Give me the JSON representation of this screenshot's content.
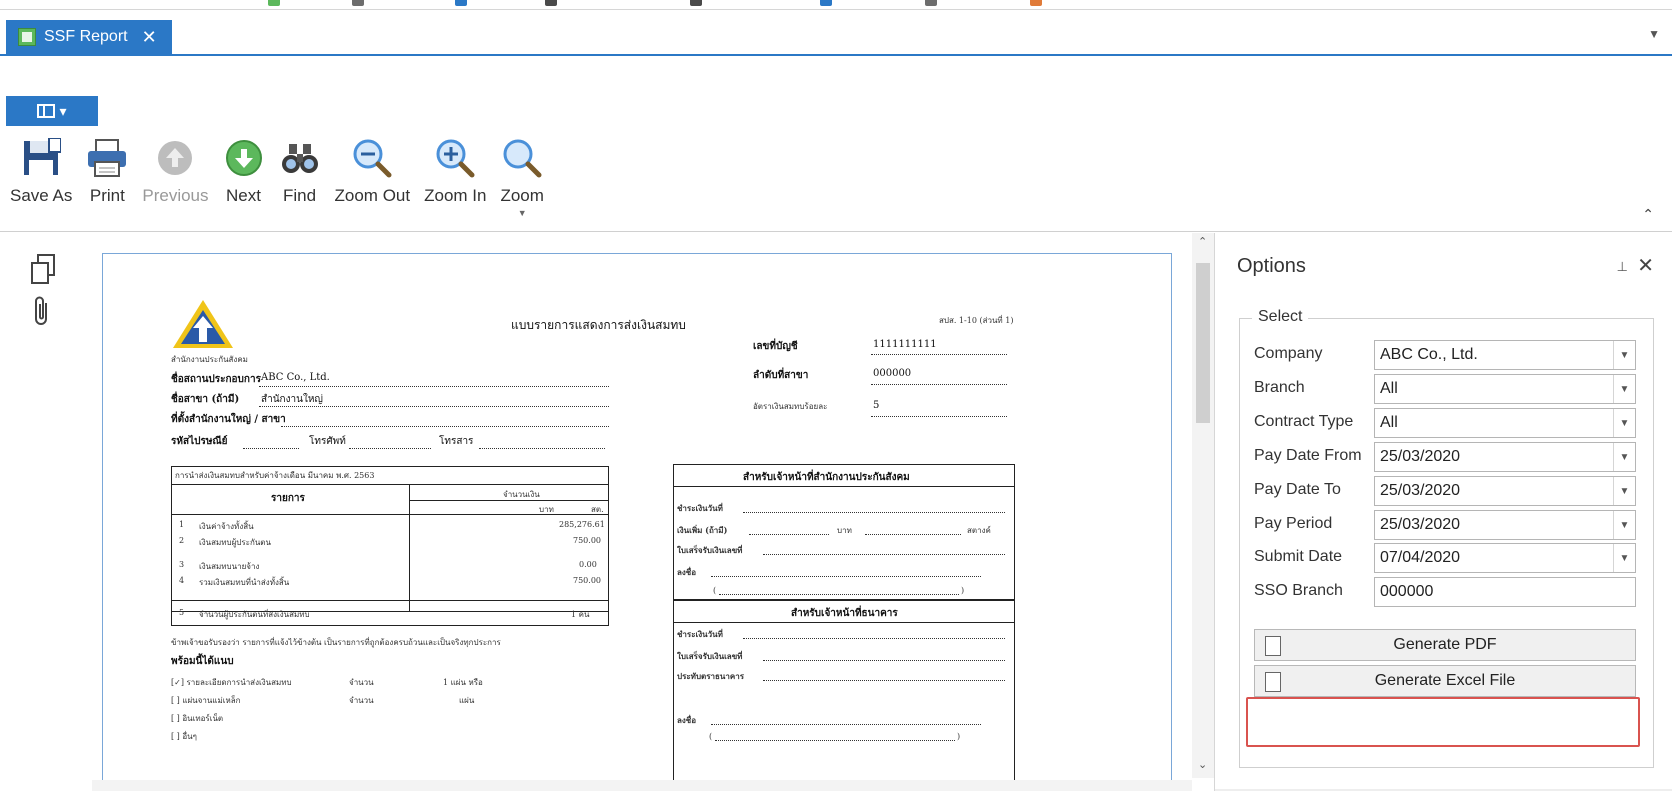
{
  "tab": {
    "title": "SSF Report",
    "close": "✕",
    "dropdown": "▼"
  },
  "ribbon": {
    "menu_button": "▾",
    "tools": [
      {
        "key": "save-as",
        "label": "Save As",
        "icon": "save-icon",
        "enabled": true
      },
      {
        "key": "print",
        "label": "Print",
        "icon": "printer-icon",
        "enabled": true
      },
      {
        "key": "previous",
        "label": "Previous",
        "icon": "arrow-up-icon",
        "enabled": false
      },
      {
        "key": "next",
        "label": "Next",
        "icon": "arrow-down-icon",
        "enabled": true
      },
      {
        "key": "find",
        "label": "Find",
        "icon": "binoculars-icon",
        "enabled": true
      },
      {
        "key": "zoom-out",
        "label": "Zoom Out",
        "icon": "zoom-out-icon",
        "enabled": true
      },
      {
        "key": "zoom-in",
        "label": "Zoom In",
        "icon": "zoom-in-icon",
        "enabled": true
      },
      {
        "key": "zoom",
        "label": "Zoom",
        "icon": "zoom-icon",
        "enabled": true
      }
    ],
    "collapse": "⌃"
  },
  "report": {
    "title": "แบบรายการแสดงการส่งเงินสมทบ",
    "form_no": "สปส. 1-10 (ส่วนที่ 1)",
    "logo_caption": "สำนักงานประกันสังคม",
    "employer_name_label": "ชื่อสถานประกอบการ",
    "employer_name": "ABC Co., Ltd.",
    "branch_label": "ชื่อสาขา (ถ้ามี)",
    "branch_value": "สำนักงานใหญ่",
    "address_label": "ที่ตั้งสำนักงานใหญ่ / สาขา",
    "postcode_label": "รหัสไปรษณีย์",
    "phone_label": "โทรศัพท์",
    "fax_label": "โทรสาร",
    "account_no_label": "เลขที่บัญชี",
    "account_no": "1111111111",
    "branch_no_label": "ลำดับที่สาขา",
    "branch_no": "000000",
    "rate_label": "อัตราเงินสมทบร้อยละ",
    "rate": "5",
    "period_line": "การนำส่งเงินสมทบสำหรับค่าจ้างเดือน มีนาคม พ.ศ. 2563",
    "col_items": "รายการ",
    "col_amount": "จำนวนเงิน",
    "col_baht": "บาท",
    "col_satang": "สต.",
    "rows": [
      {
        "no": "1",
        "text": "เงินค่าจ้างทั้งสิ้น",
        "amount": "285,276.61"
      },
      {
        "no": "2",
        "text": "เงินสมทบผู้ประกันตน",
        "amount": "750.00"
      },
      {
        "no": "3",
        "text": "เงินสมทบนายจ้าง",
        "amount": "0.00"
      },
      {
        "no": "4",
        "text": "รวมเงินสมทบที่นำส่งทั้งสิ้น",
        "amount": "750.00"
      },
      {
        "no": "5",
        "text": "จำนวนผู้ประกันตนที่ส่งเงินสมทบ",
        "amount": "1 คน"
      }
    ],
    "note_line": "ข้าพเจ้าขอรับรองว่า รายการที่แจ้งไว้ข้างต้น เป็นรายการที่ถูกต้องครบถ้วนและเป็นจริงทุกประการ",
    "attach_label": "พร้อมนี้ได้แนบ",
    "attach_1": "[✓] รายละเอียดการนำส่งเงินสมทบ",
    "attach_1_qty": "จำนวน",
    "attach_1_unit": "1 แผ่น หรือ",
    "attach_2": "[ ] แผ่นจานแม่เหล็ก",
    "attach_2_qty": "จำนวน",
    "attach_2_unit": "แผ่น",
    "attach_3": "[ ] อินเทอร์เน็ต",
    "attach_4": "[ ] อื่นๆ",
    "office_header": "สำหรับเจ้าหน้าที่สำนักงานประกันสังคม",
    "office_line1": "ชำระเงินวันที่",
    "office_line2_a": "เงินเพิ่ม (ถ้ามี)",
    "office_line2_b": "บาท",
    "office_line2_c": "สตางค์",
    "office_line3": "ใบเสร็จรับเงินเลขที่",
    "office_line4": "ลงชื่อ",
    "bank_header": "สำหรับเจ้าหน้าที่ธนาคาร",
    "bank_line1": "ชำระเงินวันที่",
    "bank_line2": "ใบเสร็จรับเงินเลขที่",
    "bank_line3": "ประทับตราธนาคาร",
    "bank_line4": "ลงชื่อ"
  },
  "options": {
    "title": "Options",
    "pin": "📌",
    "close": "✕",
    "group_label": "Select",
    "fields": [
      {
        "key": "company",
        "label": "Company",
        "value": "ABC Co., Ltd.",
        "has_dropdown": true
      },
      {
        "key": "branch",
        "label": "Branch",
        "value": "All",
        "has_dropdown": true
      },
      {
        "key": "contract-type",
        "label": "Contract Type",
        "value": "All",
        "has_dropdown": true
      },
      {
        "key": "pay-date-from",
        "label": "Pay Date From",
        "value": "25/03/2020",
        "has_dropdown": true
      },
      {
        "key": "pay-date-to",
        "label": "Pay Date To",
        "value": "25/03/2020",
        "has_dropdown": true
      },
      {
        "key": "pay-period",
        "label": "Pay Period",
        "value": "25/03/2020",
        "has_dropdown": true
      },
      {
        "key": "submit-date",
        "label": "Submit Date",
        "value": "07/04/2020",
        "has_dropdown": true
      },
      {
        "key": "sso-branch",
        "label": "SSO Branch",
        "value": "000000",
        "has_dropdown": false
      }
    ],
    "generate_pdf": "Generate PDF",
    "generate_excel": "Generate Excel File"
  },
  "colors": {
    "accent": "#2b78c6",
    "highlight": "#d9534f",
    "next_green": "#5cb85c",
    "zoom_blue": "#4a90d9"
  }
}
